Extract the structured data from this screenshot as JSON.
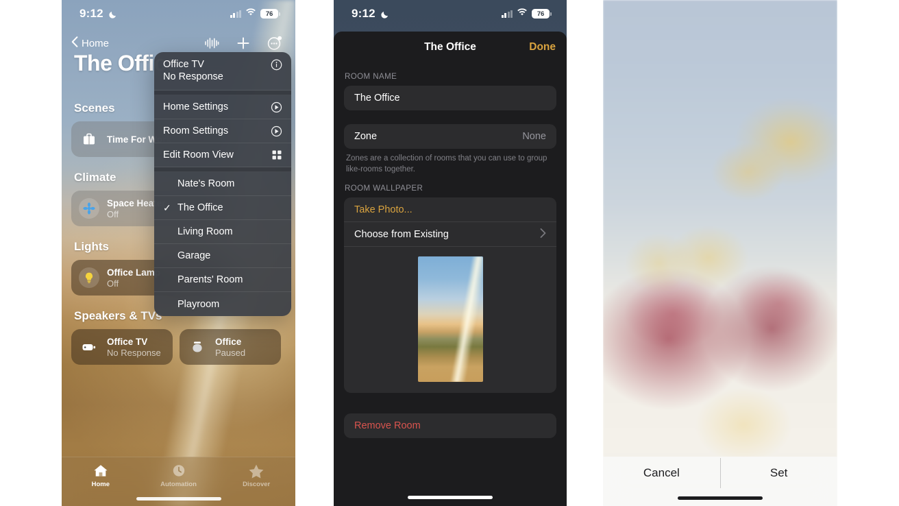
{
  "colors": {
    "accent_done": "#d9a33f",
    "accent_take_photo": "#d9a33f",
    "danger": "#d9544e",
    "sheet_bg": "#1c1c1e",
    "row_bg": "#2c2c2e",
    "menu_bg": "#3a3e46"
  },
  "status_bar": {
    "time": "9:12",
    "moon_icon": "crescent-moon-icon",
    "cellular_icon": "cellular-bars-icon",
    "wifi_icon": "wifi-icon",
    "battery_level": "76"
  },
  "left_panel": {
    "nav": {
      "back_label": "Home",
      "back_icon": "chevron-left-icon",
      "audio_icon": "audio-waveform-icon",
      "add_icon": "plus-icon",
      "more_icon": "more-ellipsis-circle-icon"
    },
    "room_title": "The Office",
    "sections": [
      {
        "title": "Scenes",
        "tiles": [
          {
            "name": "Time For Work",
            "state": "",
            "icon": "briefcase-icon",
            "style": "light",
            "width": "wide"
          }
        ]
      },
      {
        "title": "Climate",
        "tiles": [
          {
            "name": "Space Heater",
            "state": "Off",
            "icon": "fan-icon",
            "style": "light",
            "width": "wide"
          }
        ]
      },
      {
        "title": "Lights",
        "tiles": [
          {
            "name": "Office Lamp",
            "state": "Off",
            "icon": "lightbulb-icon",
            "style": "dark",
            "width": "wide"
          }
        ]
      },
      {
        "title": "Speakers & TVs",
        "tiles": [
          {
            "name": "Office TV",
            "state": "No Response",
            "icon": "appletv-icon",
            "style": "dark",
            "width": "half"
          },
          {
            "name": "Office",
            "state": "Paused",
            "icon": "homepod-icon",
            "style": "dark",
            "width": "half"
          }
        ]
      }
    ],
    "tabs": [
      {
        "label": "Home",
        "icon": "house-icon",
        "active": true
      },
      {
        "label": "Automation",
        "icon": "automation-clock-icon",
        "active": false
      },
      {
        "label": "Discover",
        "icon": "star-icon",
        "active": false
      }
    ]
  },
  "context_menu": {
    "header": {
      "line1": "Office TV",
      "line2": "No Response",
      "icon": "info-circle-icon"
    },
    "actions": [
      {
        "label": "Home Settings",
        "icon": "gear-icon"
      },
      {
        "label": "Room Settings",
        "icon": "gear-icon"
      },
      {
        "label": "Edit Room View",
        "icon": "grid-icon"
      }
    ],
    "rooms": [
      {
        "label": "Nate's Room",
        "checked": false
      },
      {
        "label": "The Office",
        "checked": true
      },
      {
        "label": "Living Room",
        "checked": false
      },
      {
        "label": "Garage",
        "checked": false
      },
      {
        "label": "Parents' Room",
        "checked": false
      },
      {
        "label": "Playroom",
        "checked": false
      }
    ],
    "check_glyph": "✓"
  },
  "middle_panel": {
    "sheet_title": "The Office",
    "done_label": "Done",
    "room_name_label": "ROOM NAME",
    "room_name_value": "The Office",
    "zone_label": "Zone",
    "zone_value": "None",
    "zone_footnote": "Zones are a collection of rooms that you can use to group like-rooms together.",
    "wallpaper_label": "ROOM WALLPAPER",
    "take_photo_label": "Take Photo...",
    "choose_existing_label": "Choose from Existing",
    "chevron_icon": "chevron-right-icon",
    "wallpaper_thumb_name": "room-wallpaper-thumbnail",
    "remove_room_label": "Remove Room"
  },
  "right_panel": {
    "photo_name": "wallpaper-preview-photo",
    "cancel_label": "Cancel",
    "set_label": "Set"
  }
}
